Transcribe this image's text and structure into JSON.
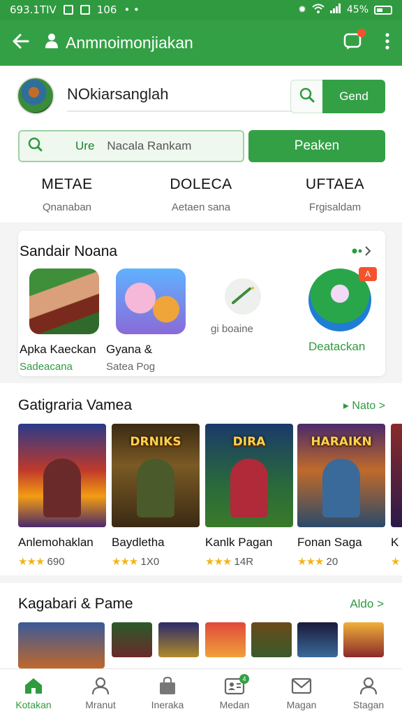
{
  "status": {
    "time": "693.1TIV",
    "date": "106",
    "battery": "45%"
  },
  "header": {
    "title": "Anmnoimonjiakan",
    "back_icon": "arrow-left-icon",
    "notification_icon": "chat-icon",
    "menu_icon": "more-vert-icon"
  },
  "profile": {
    "name": "NOkiarsanglah",
    "follow_button": "Gend",
    "search_tag": "Ure",
    "search_value": "Nacala Rankam",
    "action_button": "Peaken",
    "stats": [
      {
        "value": "METAE",
        "label": "Qnanaban"
      },
      {
        "value": "DOLECA",
        "label": "Aetaen sana"
      },
      {
        "value": "UFTAEA",
        "label": "Frgisaldam"
      }
    ]
  },
  "recommended": {
    "title": "Sandair Noana",
    "items": [
      {
        "name": "Apka Kaeckan",
        "sub": "Sadeacana",
        "sub_color": "#2f9a3f"
      },
      {
        "name": "Gyana &",
        "sub": "Satea Pog",
        "sub_color": "#666666"
      },
      {
        "name": "",
        "sub": "gi boaine",
        "sub_color": "#666666"
      },
      {
        "name": "Deatackan",
        "sub": "",
        "sub_color": "#2f9a3f",
        "badge": "A"
      }
    ]
  },
  "games": {
    "title": "Gatigraria Vamea",
    "more": "Nato",
    "items": [
      {
        "name": "Anlemohaklan",
        "rating": "690",
        "art_title": ""
      },
      {
        "name": "Baydletha",
        "rating": "1X0",
        "art_title": "DRNIKS"
      },
      {
        "name": "Kanlk Pagan",
        "rating": "14R",
        "art_title": "DIRA"
      },
      {
        "name": "Fonan Saga",
        "rating": "20",
        "art_title": "HARAIKN"
      },
      {
        "name": "K",
        "rating": "",
        "art_title": ""
      }
    ]
  },
  "section3": {
    "title": "Kagabari & Pame",
    "more": "Aldo"
  },
  "bottom_nav": [
    {
      "label": "Kotakan",
      "icon": "home-icon",
      "active": true
    },
    {
      "label": "Mranut",
      "icon": "person-icon",
      "active": false
    },
    {
      "label": "Ineraka",
      "icon": "bag-icon",
      "active": false
    },
    {
      "label": "Medan",
      "icon": "contact-card-icon",
      "active": false,
      "badge": "4"
    },
    {
      "label": "Magan",
      "icon": "mail-icon",
      "active": false
    },
    {
      "label": "Stagan",
      "icon": "profile-icon",
      "active": false
    }
  ],
  "colors": {
    "primary": "#34a046",
    "status_bar": "#2f9a3f",
    "star": "#f3b416",
    "badge": "#f4522d"
  }
}
